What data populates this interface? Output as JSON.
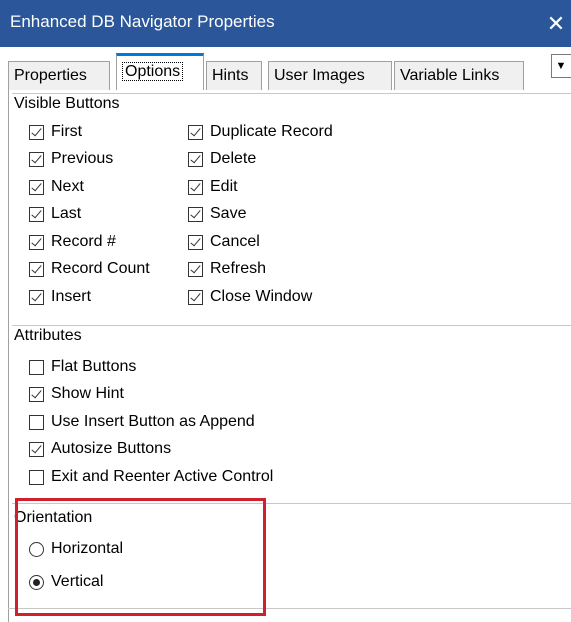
{
  "window": {
    "title": "Enhanced DB Navigator Properties",
    "close_glyph": "✕"
  },
  "tabs": [
    {
      "label": "Properties",
      "active": false
    },
    {
      "label": "Options",
      "active": true
    },
    {
      "label": "Hints",
      "active": false
    },
    {
      "label": "User Images",
      "active": false
    },
    {
      "label": "Variable Links",
      "active": false
    }
  ],
  "tab_overflow_icon": "chevron-down-icon",
  "visible_buttons": {
    "title": "Visible Buttons",
    "left": [
      {
        "label": "First",
        "checked": true
      },
      {
        "label": "Previous",
        "checked": true
      },
      {
        "label": "Next",
        "checked": true
      },
      {
        "label": "Last",
        "checked": true
      },
      {
        "label": "Record #",
        "checked": true
      },
      {
        "label": "Record Count",
        "checked": true
      },
      {
        "label": "Insert",
        "checked": true
      }
    ],
    "right": [
      {
        "label": "Duplicate Record",
        "checked": true
      },
      {
        "label": "Delete",
        "checked": true
      },
      {
        "label": "Edit",
        "checked": true
      },
      {
        "label": "Save",
        "checked": true
      },
      {
        "label": "Cancel",
        "checked": true
      },
      {
        "label": "Refresh",
        "checked": true
      },
      {
        "label": "Close Window",
        "checked": true
      }
    ]
  },
  "attributes": {
    "title": "Attributes",
    "items": [
      {
        "label": "Flat Buttons",
        "checked": false
      },
      {
        "label": "Show Hint",
        "checked": true
      },
      {
        "label": "Use Insert Button as Append",
        "checked": false
      },
      {
        "label": "Autosize Buttons",
        "checked": true
      },
      {
        "label": "Exit and Reenter Active Control",
        "checked": false
      }
    ]
  },
  "orientation": {
    "title": "Orientation",
    "options": [
      {
        "label": "Horizontal",
        "selected": false
      },
      {
        "label": "Vertical",
        "selected": true
      }
    ]
  },
  "colors": {
    "title_bar": "#2b579a",
    "active_tab_accent": "#0078d7",
    "highlight_border": "#d0202d"
  }
}
